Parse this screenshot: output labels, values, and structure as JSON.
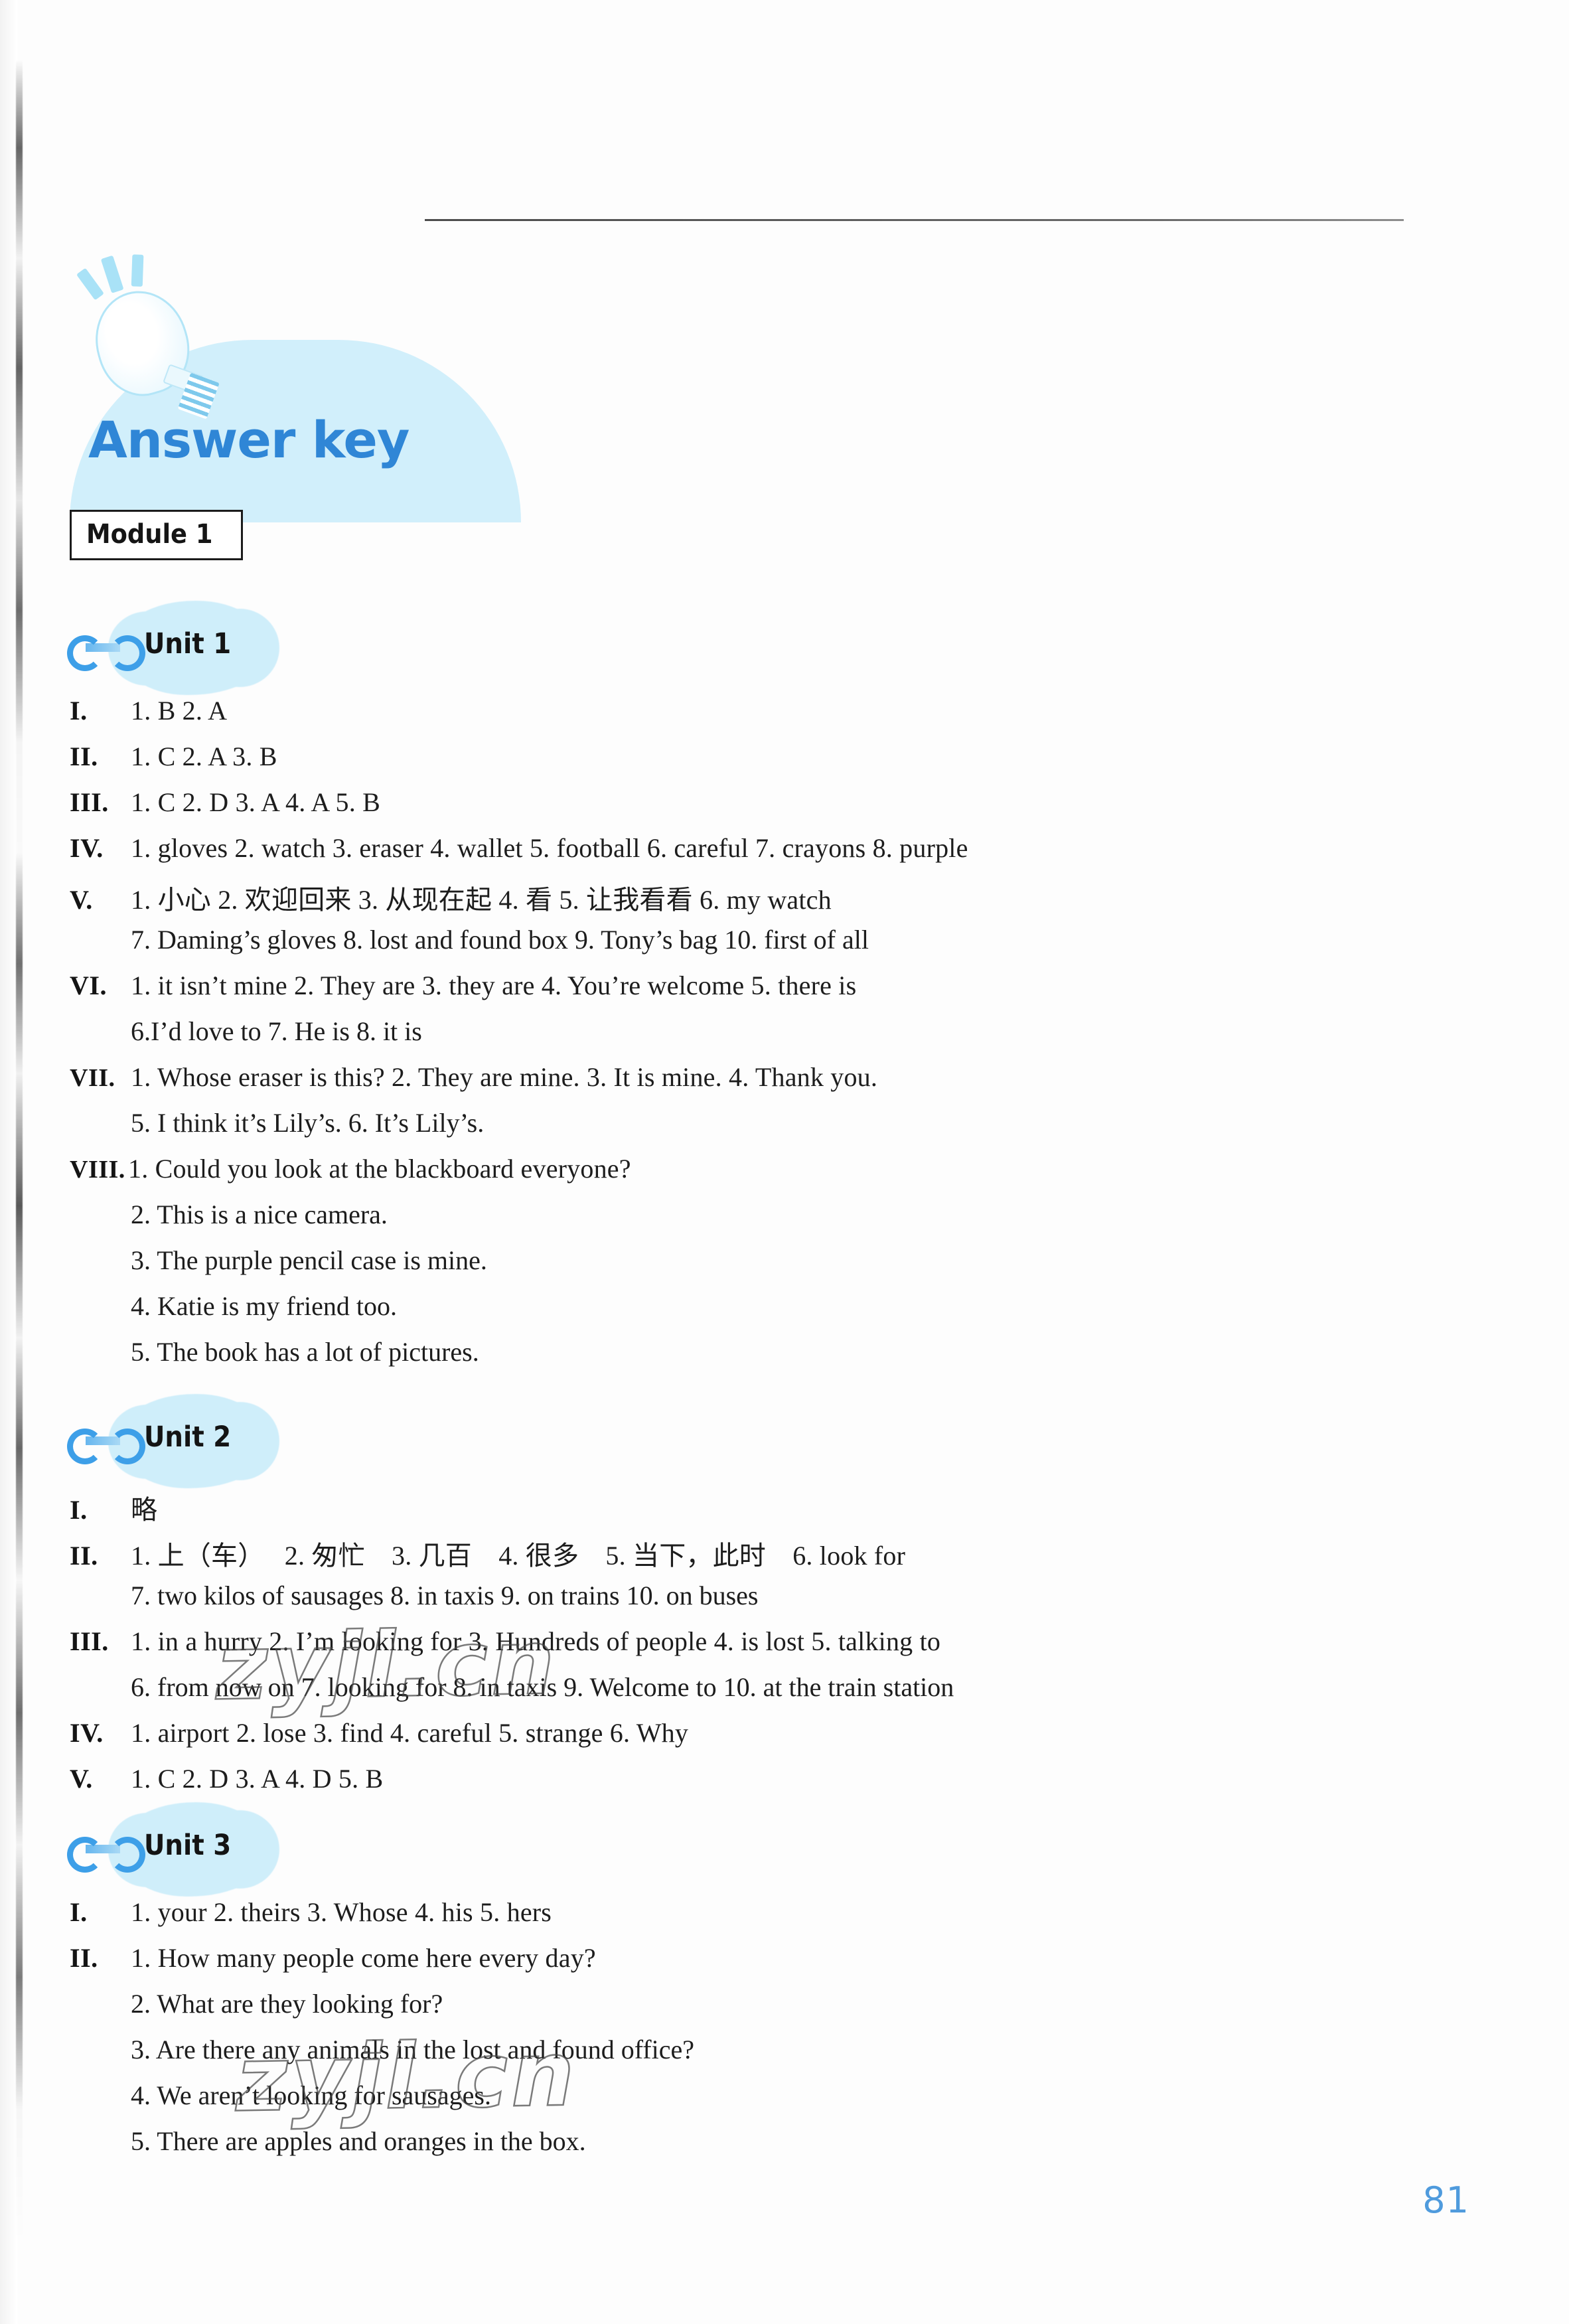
{
  "page": {
    "title": "Answer key",
    "page_number": "81",
    "watermark_text": "zyjl.cn"
  },
  "module": {
    "label": "Module 1"
  },
  "units": [
    {
      "label": "Unit 1",
      "sections": [
        {
          "roman": "I.",
          "lines": [
            "1. B   2. A"
          ]
        },
        {
          "roman": "II.",
          "lines": [
            "1. C   2. A   3. B"
          ]
        },
        {
          "roman": "III.",
          "lines": [
            "1. C   2. D   3. A   4. A   5. B"
          ]
        },
        {
          "roman": "IV.",
          "lines": [
            "1. gloves  2. watch  3. eraser  4. wallet  5. football  6. careful  7. crayons  8. purple"
          ]
        },
        {
          "roman": "V.",
          "lines": [
            "1. 小心   2. 欢迎回来   3. 从现在起   4. 看   5. 让我看看   6. my watch",
            "7. Daming’s gloves   8. lost and found box   9. Tony’s bag   10. first of all"
          ]
        },
        {
          "roman": "VI.",
          "lines": [
            "1. it isn’t mine   2. They are   3. they are   4. You’re welcome   5. there is",
            "6.I’d love to   7. He is   8. it is"
          ]
        },
        {
          "roman": "VII.",
          "lines": [
            "1. Whose eraser is this?   2. They are mine.   3. It is mine.   4. Thank you.",
            "5. I think it’s Lily’s.   6. It’s Lily’s."
          ]
        },
        {
          "roman": "VIII.",
          "lines": [
            "1. Could you look at the blackboard everyone?",
            "2. This is a nice camera.",
            "3. The purple pencil case is mine.",
            "4. Katie is my friend too.",
            "5. The book has a lot of pictures."
          ]
        }
      ]
    },
    {
      "label": "Unit 2",
      "sections": [
        {
          "roman": "I.",
          "lines": [
            "略"
          ]
        },
        {
          "roman": "II.",
          "lines": [
            "1. 上（车）　 2. 匆忙　3. 几百　4. 很多　5. 当下，此时　6. look for",
            "7. two kilos of sausages   8. in taxis   9. on trains   10. on buses"
          ]
        },
        {
          "roman": "III.",
          "lines": [
            "1. in a hurry   2. I’m looking for   3. Hundreds of people   4. is lost   5. talking to",
            "6. from now on   7. looking for   8. in taxis   9. Welcome to   10. at the train station"
          ]
        },
        {
          "roman": "IV.",
          "lines": [
            "1. airport   2. lose   3. find   4. careful   5. strange   6. Why"
          ]
        },
        {
          "roman": "V.",
          "lines": [
            "1. C   2. D   3. A   4. D   5. B"
          ]
        }
      ]
    },
    {
      "label": "Unit 3",
      "sections": [
        {
          "roman": "I.",
          "lines": [
            "1. your   2. theirs   3. Whose   4. his   5. hers"
          ]
        },
        {
          "roman": "II.",
          "lines": [
            "1. How many people come here every day?",
            "2. What are they looking for?",
            "3. Are there any animals in the lost and found office?",
            "4. We aren’t looking for sausages.",
            "5. There are apples and oranges in the box."
          ]
        }
      ]
    }
  ]
}
